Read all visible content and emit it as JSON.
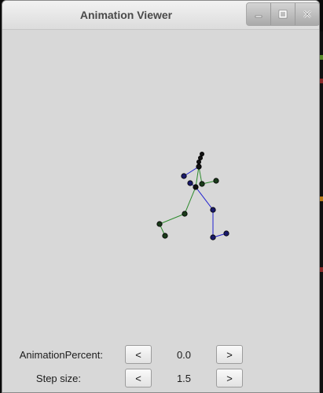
{
  "window": {
    "title": "Animation Viewer",
    "controls": [
      "minimize-icon",
      "maximize-icon",
      "close-icon"
    ]
  },
  "controls": {
    "animation_percent": {
      "label": "AnimationPercent:",
      "decrease_label": "<",
      "value": "0.0",
      "increase_label": ">"
    },
    "step_size": {
      "label": "Step size:",
      "decrease_label": "<",
      "value": "1.5",
      "increase_label": ">"
    }
  },
  "colors": {
    "left_limb": "#2e8b2e",
    "right_limb": "#1f1fd0",
    "joint": "#000000",
    "background": "#d8d8d8"
  }
}
